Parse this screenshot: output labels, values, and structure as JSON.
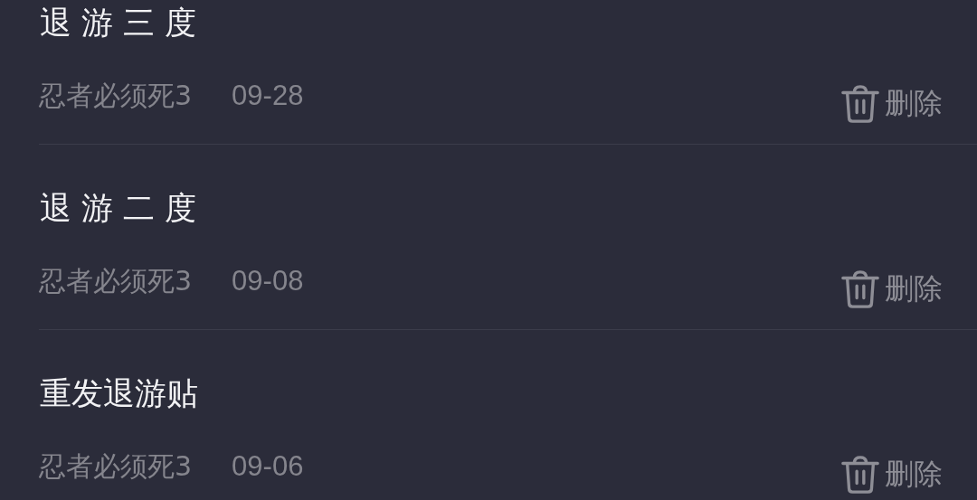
{
  "posts": [
    {
      "title": "退 游 三 度",
      "game": "忍者必须死3",
      "date": "09-28",
      "action": "删除"
    },
    {
      "title": "退 游 二 度",
      "game": "忍者必须死3",
      "date": "09-08",
      "action": "删除"
    },
    {
      "title": "重发退游贴",
      "game": "忍者必须死3",
      "date": "09-06",
      "action": "删除"
    }
  ]
}
